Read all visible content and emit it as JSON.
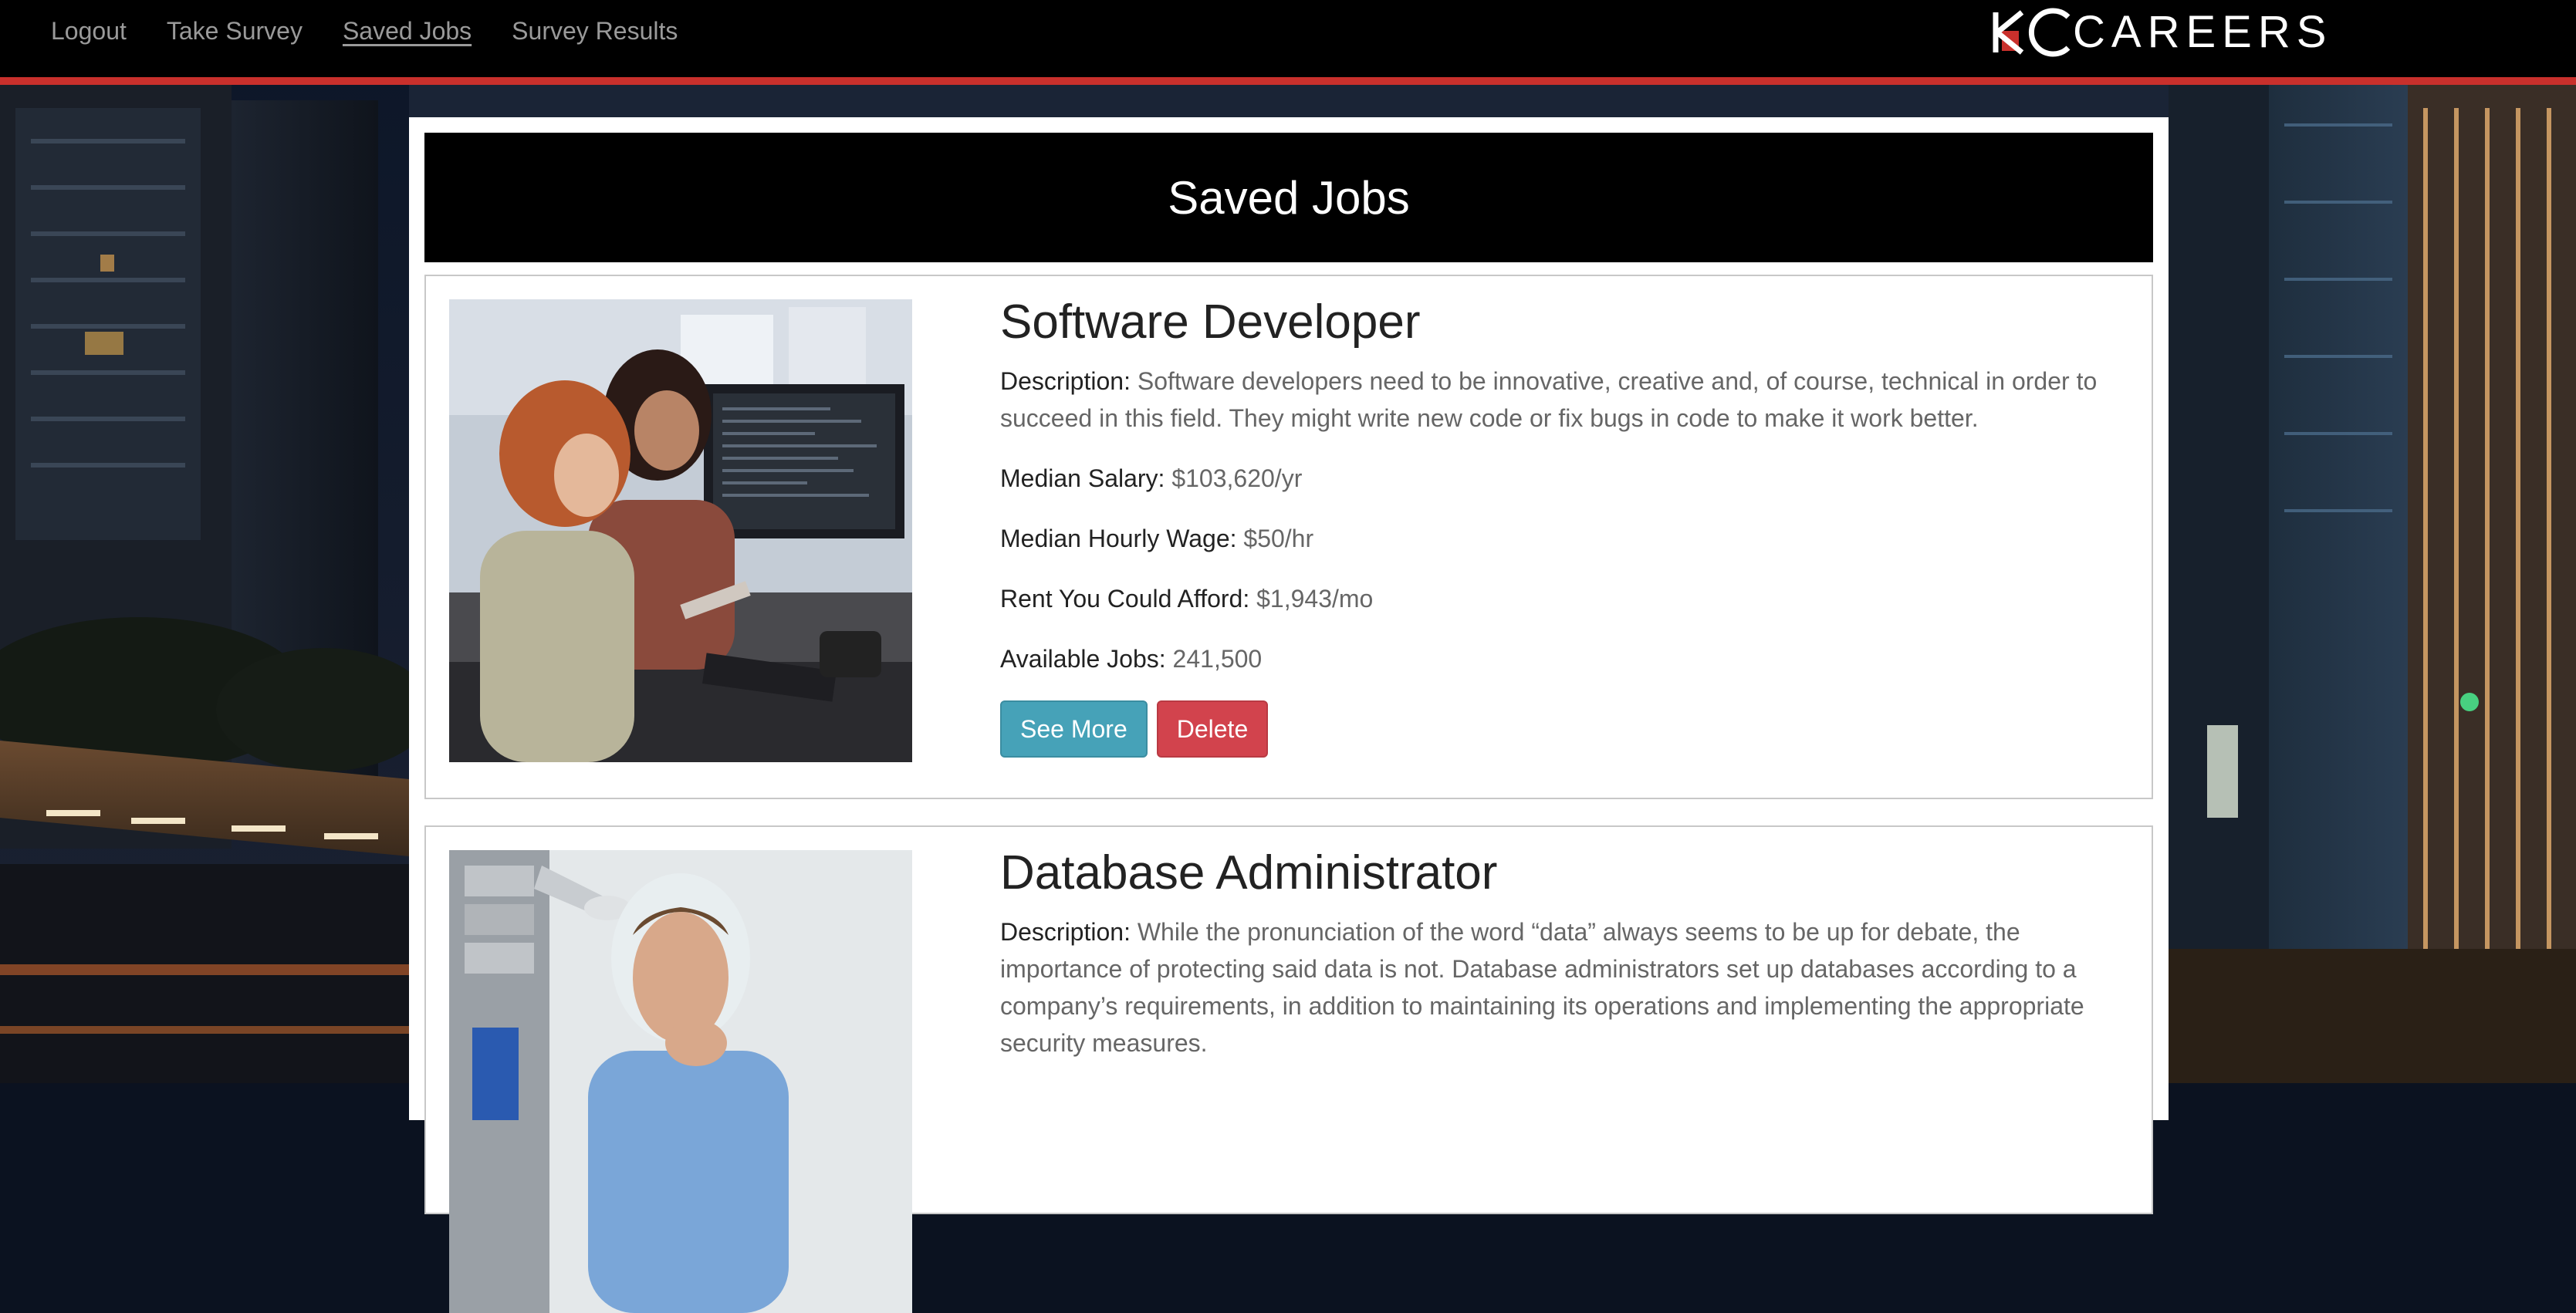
{
  "nav": {
    "links": [
      "Logout",
      "Take Survey",
      "Saved Jobs",
      "Survey Results"
    ],
    "active_link": "Saved Jobs"
  },
  "brand": {
    "mark": "KC",
    "text": "CAREERS"
  },
  "page": {
    "title": "Saved Jobs"
  },
  "jobs": [
    {
      "title": "Software Developer",
      "description_label": "Description:",
      "description": "Software developers need to be innovative, creative and, of course, technical in order to succeed in this field. They might write new code or fix bugs in code to make it work better.",
      "salary_label": "Median Salary:",
      "salary": "$103,620/yr",
      "wage_label": "Median Hourly Wage:",
      "wage": "$50/hr",
      "rent_label": "Rent You Could Afford:",
      "rent": "$1,943/mo",
      "available_label": "Available Jobs:",
      "available": "241,500",
      "see_more_label": "See More",
      "delete_label": "Delete",
      "photo": "two-women-at-computer-photo"
    },
    {
      "title": "Database Administrator",
      "description_label": "Description:",
      "description": "While the pronunciation of the word “data” always seems to be up for debate, the importance of protecting said data is not. Database administrators set up databases according to a company’s requirements, in addition to maintaining its operations and implementing the appropriate security measures.",
      "photo": "man-in-server-room-photo"
    }
  ],
  "colors": {
    "nav_bg": "#000000",
    "nav_accent": "#c9302c",
    "see_more": "#46a2b8",
    "delete": "#d2434d",
    "title_bar": "#000000"
  }
}
